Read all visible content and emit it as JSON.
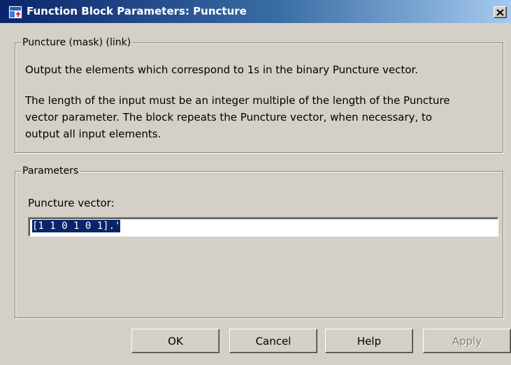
{
  "window": {
    "title": "Function Block Parameters: Puncture",
    "close_label": "×"
  },
  "description_group": {
    "legend": "Puncture (mask) (link)",
    "lines": [
      "Output the elements which correspond to 1s in the binary Puncture vector.",
      "The length of the input must be an integer multiple of the length of the Puncture",
      "vector parameter. The block repeats the Puncture vector, when necessary, to",
      "output all input elements."
    ]
  },
  "parameters_group": {
    "legend": "Parameters",
    "puncture_vector_label": "Puncture vector:",
    "puncture_vector_value": "[1 1 0 1 0 1].'"
  },
  "buttons": {
    "ok": "OK",
    "cancel": "Cancel",
    "help": "Help",
    "apply": "Apply"
  },
  "colors": {
    "titlebar_start": "#0a246a",
    "titlebar_end": "#a6caf0",
    "dialog_background": "#d4d0c8",
    "selection": "#0a246a",
    "disabled_text": "#808080"
  },
  "icons": {
    "app": "simulink-block-icon",
    "close": "close-icon"
  },
  "state": {
    "apply_enabled": false,
    "puncture_vector_text_selected": true
  }
}
